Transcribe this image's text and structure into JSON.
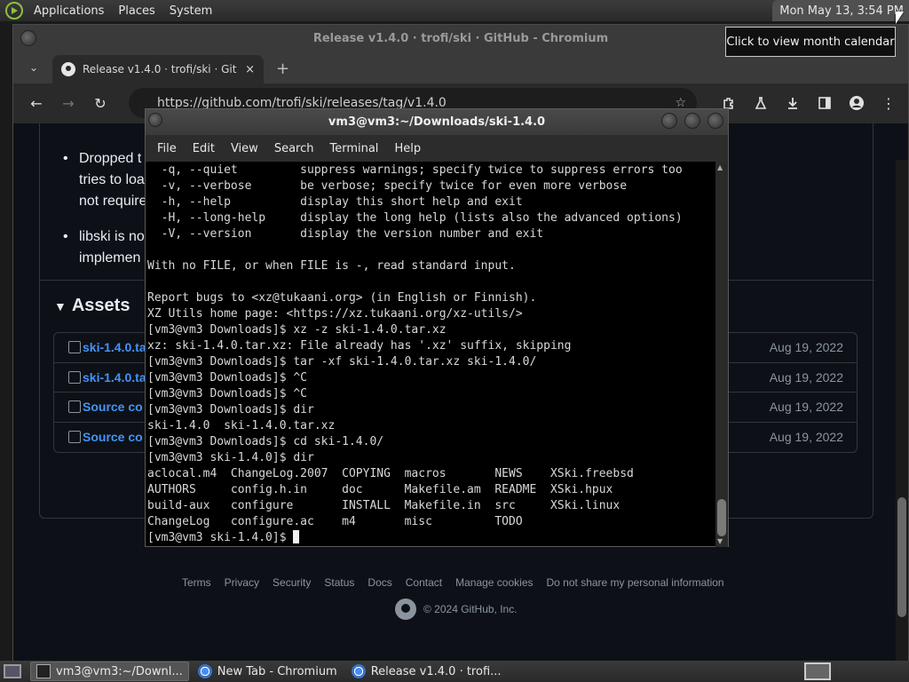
{
  "top_panel": {
    "menus": [
      "Applications",
      "Places",
      "System"
    ],
    "clock": "Mon May 13,  3:54 PM",
    "tooltip": "Click to view month calendar"
  },
  "chromium": {
    "window_title": "Release v1.4.0 · trofi/ski · GitHub - Chromium",
    "tab_title": "Release v1.4.0 · trofi/ski · Git",
    "tab_close": "×",
    "new_tab": "+",
    "tab_search": "⌄",
    "url": "https://github.com/trofi/ski/releases/tag/v1.4.0",
    "toolbar": {
      "back": "←",
      "forward": "→",
      "reload": "↻",
      "star": "☆",
      "menu": "⋮"
    },
    "page": {
      "notes": [
        {
          "line1": "Dropped t",
          "line2": "tries to loa",
          "line3": "not require"
        },
        {
          "line1": "libski is no",
          "line2": "implemen"
        }
      ],
      "assets_heading": "Assets",
      "assets_caret": "▼",
      "assets": [
        {
          "name": "ski-1.4.0.ta",
          "date": "Aug 19, 2022",
          "icon": "package-icon"
        },
        {
          "name": "ski-1.4.0.ta",
          "date": "Aug 19, 2022",
          "icon": "package-icon"
        },
        {
          "name": "Source co",
          "date": "Aug 19, 2022",
          "icon": "file-zip-icon"
        },
        {
          "name": "Source co",
          "date": "Aug 19, 2022",
          "icon": "file-zip-icon"
        }
      ],
      "footer_links": [
        "Terms",
        "Privacy",
        "Security",
        "Status",
        "Docs",
        "Contact",
        "Manage cookies",
        "Do not share my personal information"
      ],
      "copyright": "© 2024 GitHub, Inc."
    }
  },
  "terminal": {
    "title": "vm3@vm3:~/Downloads/ski-1.4.0",
    "menus": [
      "File",
      "Edit",
      "View",
      "Search",
      "Terminal",
      "Help"
    ],
    "scroll_up": "▲",
    "scroll_down": "▼",
    "output": "  -q, --quiet         suppress warnings; specify twice to suppress errors too\n  -v, --verbose       be verbose; specify twice for even more verbose\n  -h, --help          display this short help and exit\n  -H, --long-help     display the long help (lists also the advanced options)\n  -V, --version       display the version number and exit\n\nWith no FILE, or when FILE is -, read standard input.\n\nReport bugs to <xz@tukaani.org> (in English or Finnish).\nXZ Utils home page: <https://xz.tukaani.org/xz-utils/>\n[vm3@vm3 Downloads]$ xz -z ski-1.4.0.tar.xz\nxz: ski-1.4.0.tar.xz: File already has '.xz' suffix, skipping\n[vm3@vm3 Downloads]$ tar -xf ski-1.4.0.tar.xz ski-1.4.0/\n[vm3@vm3 Downloads]$ ^C\n[vm3@vm3 Downloads]$ ^C\n[vm3@vm3 Downloads]$ dir\nski-1.4.0  ski-1.4.0.tar.xz\n[vm3@vm3 Downloads]$ cd ski-1.4.0/\n[vm3@vm3 ski-1.4.0]$ dir\naclocal.m4  ChangeLog.2007  COPYING  macros       NEWS    XSki.freebsd\nAUTHORS     config.h.in     doc      Makefile.am  README  XSki.hpux\nbuild-aux   configure       INSTALL  Makefile.in  src     XSki.linux\nChangeLog   configure.ac    m4       misc         TODO",
    "prompt": "[vm3@vm3 ski-1.4.0]$ "
  },
  "taskbar": {
    "items": [
      {
        "label": "vm3@vm3:~/Downl...",
        "icon": "terminal-icon"
      },
      {
        "label": "New Tab - Chromium",
        "icon": "chromium-icon"
      },
      {
        "label": "Release v1.4.0 · trofi...",
        "icon": "chromium-icon"
      }
    ]
  }
}
